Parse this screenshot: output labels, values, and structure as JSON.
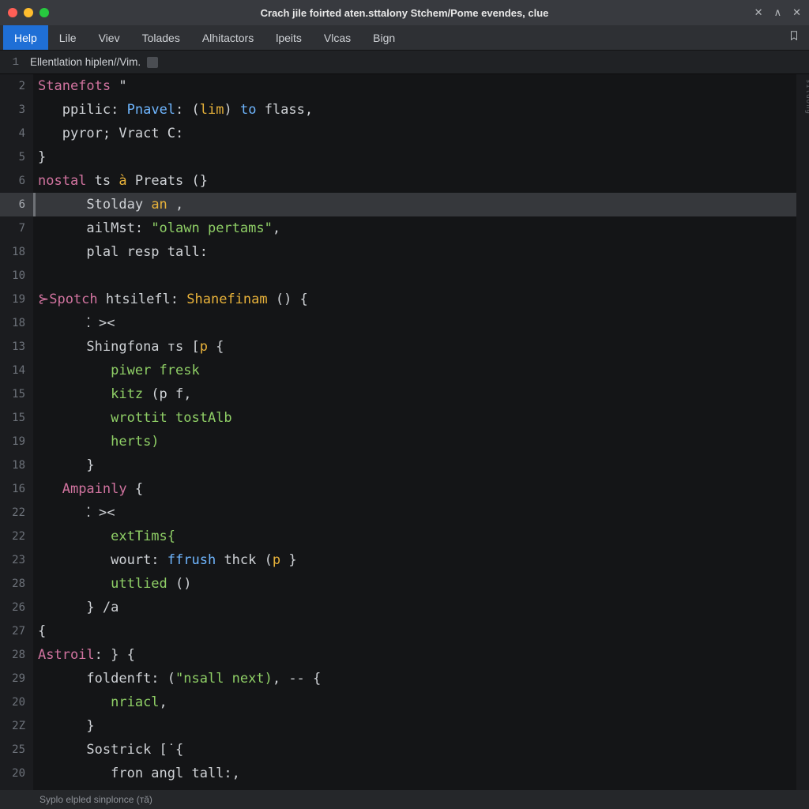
{
  "title": "Crach jile foirted aten.sttalony Stchem/Pome evendes, clue",
  "menus": {
    "help": "Help",
    "lile": "Lile",
    "viev": "Viev",
    "tolades": "Tolades",
    "alhitactors": "Alhitactors",
    "lpeits": "lpeits",
    "vlcas": "Vlcas",
    "bign": "Bign"
  },
  "breadcrumb": {
    "num": "1",
    "text": "Ellentlation hiplen//Vim."
  },
  "gutter": [
    "2",
    "3",
    "4",
    "5",
    "6",
    "6",
    "7",
    "18",
    "10",
    "19",
    "18",
    "13",
    "14",
    "15",
    "15",
    "19",
    "18",
    "16",
    "22",
    "22",
    "23",
    "28",
    "26",
    "27",
    "28",
    "29",
    "20",
    "2Z",
    "25",
    "20"
  ],
  "code": {
    "l0": {
      "a": "Stanefots ",
      "b": "\""
    },
    "l1": {
      "a": "ppilic",
      "b": ": ",
      "c": "Pnavel",
      "d": ": (",
      "e": "lim",
      "f": ") ",
      "g": "to",
      "h": " flass,"
    },
    "l2": {
      "a": "pyror",
      "b": "; Vract C:"
    },
    "l3": {
      "a": "}"
    },
    "l4": {
      "a": "nostal",
      "b": " ts ",
      "c": "à",
      "d": " Preats (}"
    },
    "l5": {
      "a": "Stolday ",
      "b": "an ",
      "c": ","
    },
    "l6": {
      "a": "ailMst: ",
      "b": "\"olawn pertams\"",
      "c": ","
    },
    "l7": {
      "a": "plal resp tall:"
    },
    "l8": {
      "a": ""
    },
    "l9": {
      "a": "⊱Spotch",
      "b": " htsilefl: ",
      "c": "Shanefinam",
      "d": " () {"
    },
    "l10": {
      "a": "⁚ ><"
    },
    "l11": {
      "a": "Shingfona ᴛs [",
      "b": "p",
      "c": " {"
    },
    "l12": {
      "a": "piwer fresk"
    },
    "l13": {
      "a": "kitz",
      "b": " (p f,"
    },
    "l14": {
      "a": "wrottit tostAlb"
    },
    "l15": {
      "a": "herts)"
    },
    "l16": {
      "a": "}"
    },
    "l17": {
      "a": "Ampainly",
      "b": " {"
    },
    "l18": {
      "a": "⁚ ><"
    },
    "l19": {
      "a": "extTims{"
    },
    "l20": {
      "a": "wourt: ",
      "b": "ffrush",
      "c": " thck (",
      "d": "p",
      "e": " }"
    },
    "l21": {
      "a": "uttlied",
      "b": " ()"
    },
    "l22": {
      "a": "} /a"
    },
    "l23": {
      "a": "{"
    },
    "l24": {
      "a": "Astroil",
      "b": ": } {"
    },
    "l25": {
      "a": "foldenft: (",
      "b": "\"nsall next)",
      "c": ", -- {"
    },
    "l26": {
      "a": "nriacl",
      "b": ","
    },
    "l27": {
      "a": "}"
    },
    "l28": {
      "a": "Sostrick [̇ {"
    },
    "l29": {
      "a": "fron angl tall:,"
    }
  },
  "scroll_label": "sildong",
  "status": "Syplo elpled sinplonce (ᴛă)"
}
